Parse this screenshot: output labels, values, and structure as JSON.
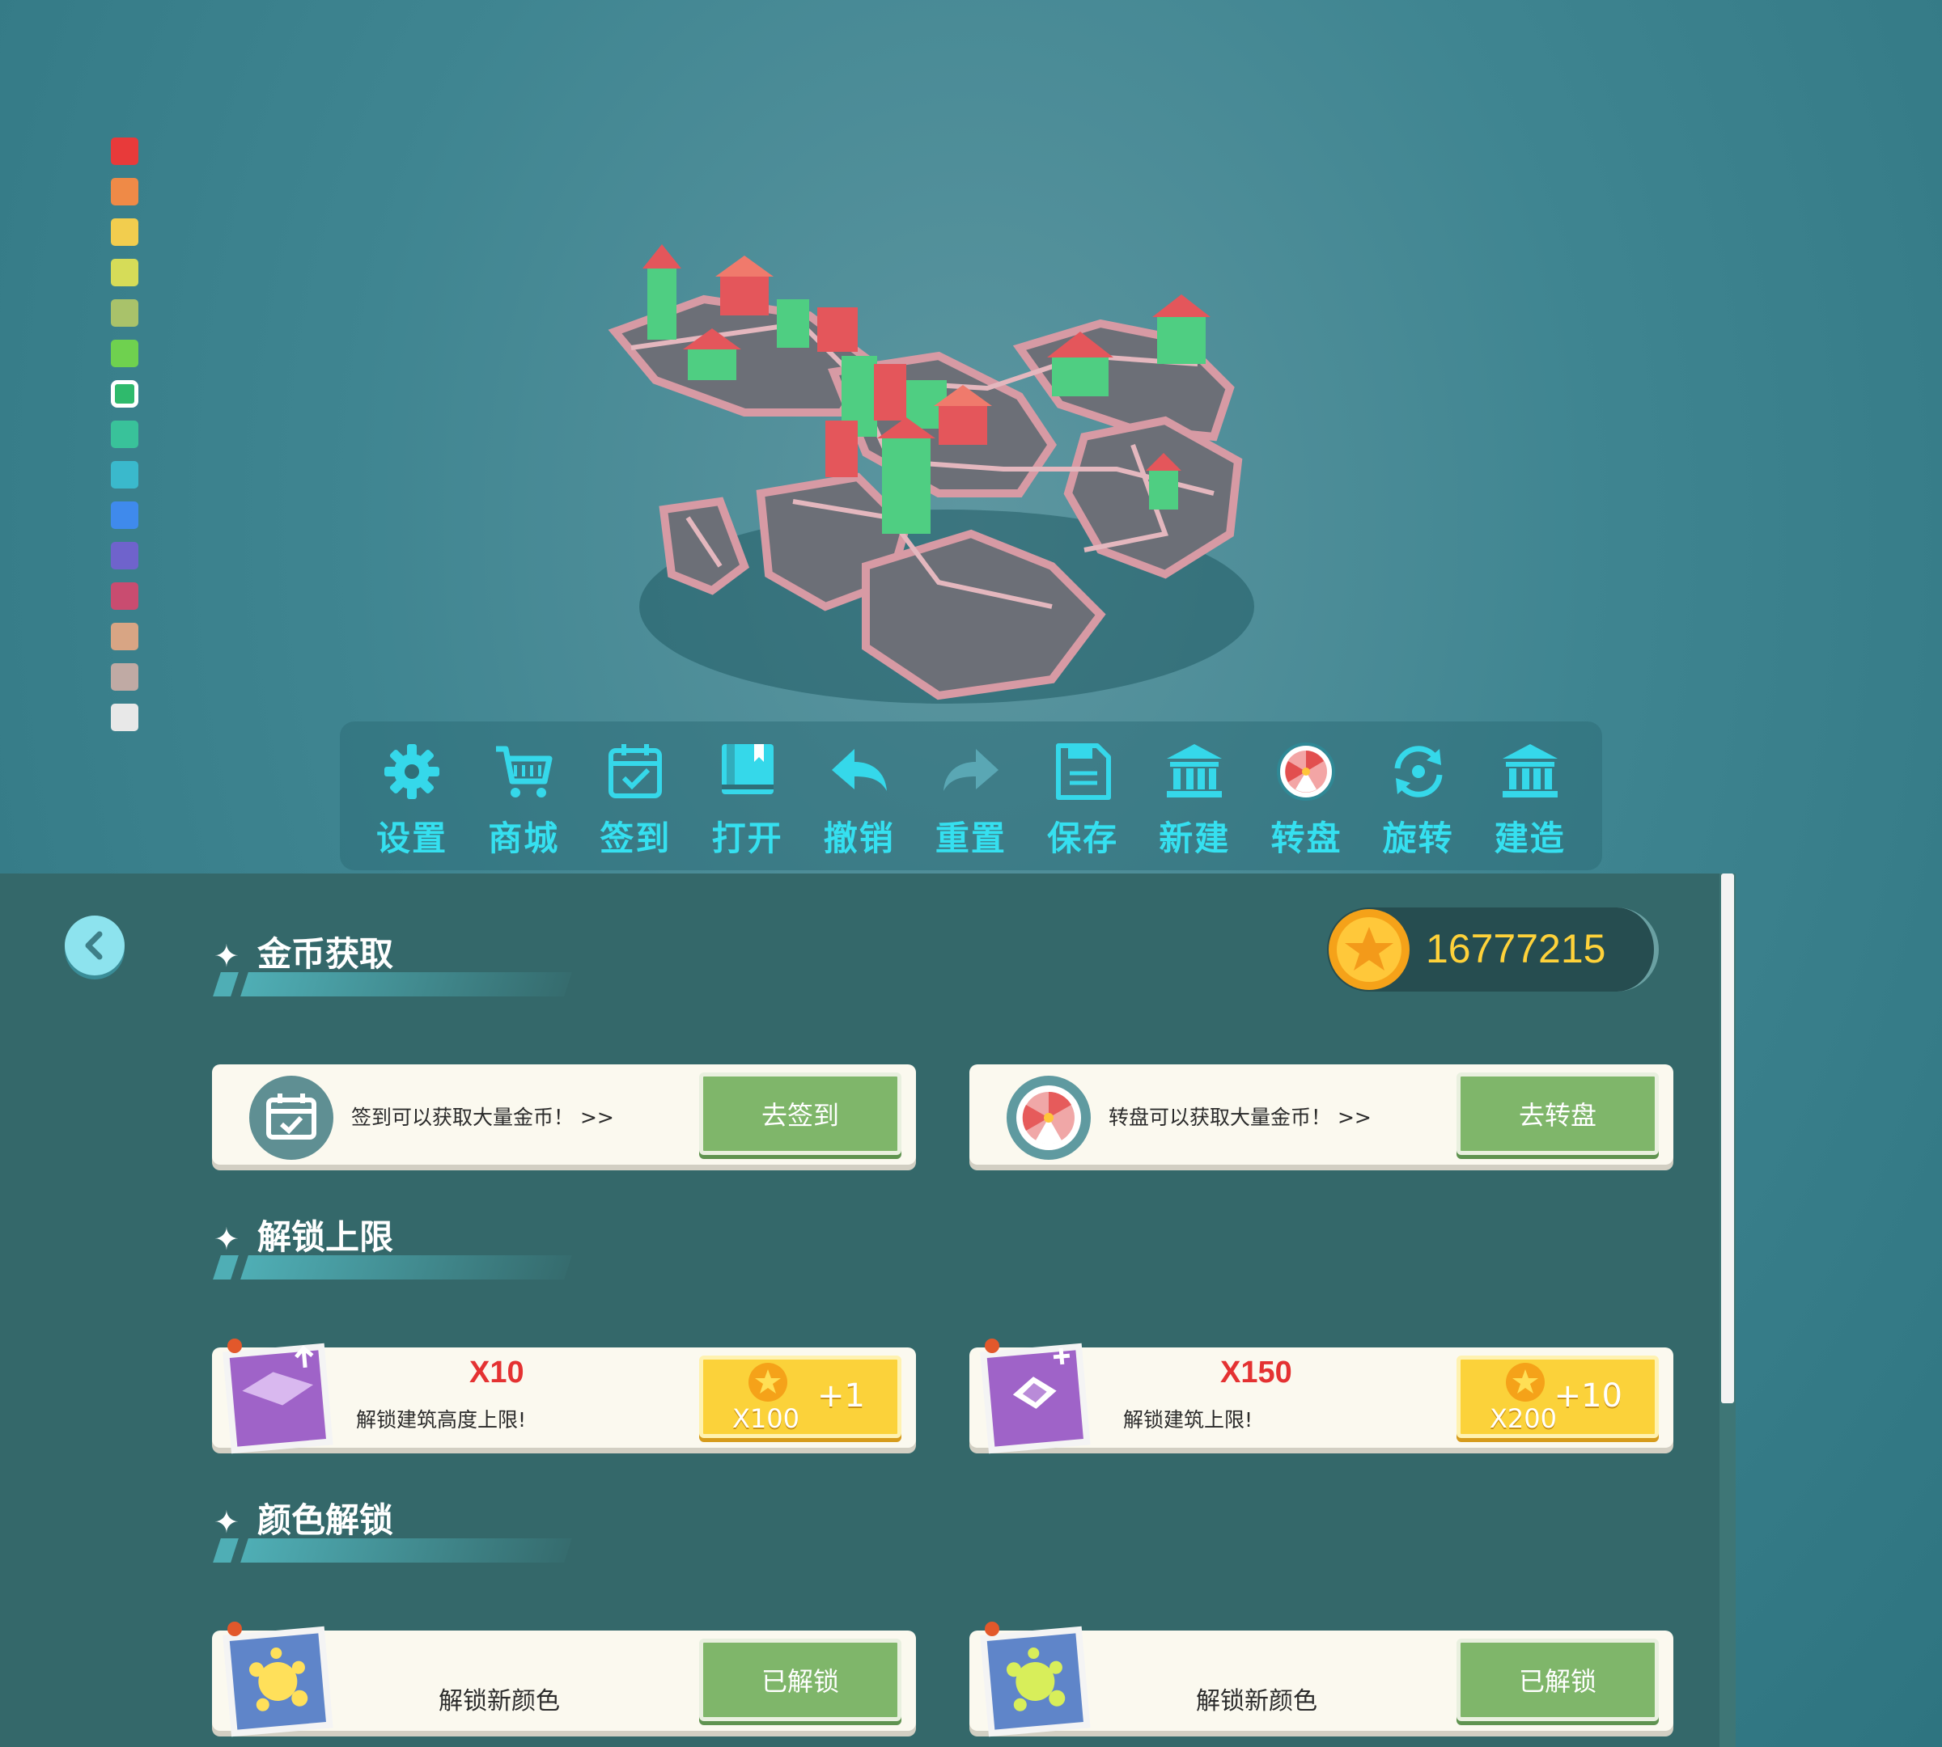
{
  "palette": {
    "colors": [
      "#e83a3a",
      "#ef8a47",
      "#f2cd4e",
      "#d6dc58",
      "#a9c26a",
      "#6fd14f",
      "#2fba6c",
      "#39c29a",
      "#3ab9cc",
      "#3f8aec",
      "#6f63cc",
      "#c94c70",
      "#d8a584",
      "#c0aaa4",
      "#e8e8e8"
    ],
    "selected_index": 6
  },
  "toolbar": {
    "items": [
      {
        "key": "settings",
        "label": "设置",
        "icon": "gear-icon"
      },
      {
        "key": "shop",
        "label": "商城",
        "icon": "cart-icon"
      },
      {
        "key": "checkin",
        "label": "签到",
        "icon": "calendar-icon"
      },
      {
        "key": "open",
        "label": "打开",
        "icon": "book-icon"
      },
      {
        "key": "undo",
        "label": "撤销",
        "icon": "undo-icon"
      },
      {
        "key": "redo",
        "label": "重置",
        "icon": "redo-icon"
      },
      {
        "key": "save",
        "label": "保存",
        "icon": "floppy-icon"
      },
      {
        "key": "new",
        "label": "新建",
        "icon": "building-icon"
      },
      {
        "key": "wheel",
        "label": "转盘",
        "icon": "wheel-icon"
      },
      {
        "key": "rotate",
        "label": "旋转",
        "icon": "rotate-icon"
      },
      {
        "key": "build",
        "label": "建造",
        "icon": "building-icon"
      }
    ]
  },
  "panel": {
    "coins": "16777215",
    "sections": {
      "earn": "金币获取",
      "unlock_limit": "解锁上限",
      "color_unlock": "颜色解锁"
    },
    "earn_cards": [
      {
        "desc": "签到可以获取大量金币！ >>",
        "button": "去签到",
        "icon": "calendar-icon"
      },
      {
        "desc": "转盘可以获取大量金币！ >>",
        "button": "去转盘",
        "icon": "wheel-icon"
      }
    ],
    "limit_cards": [
      {
        "amount": "X10",
        "desc": "解锁建筑高度上限!",
        "plus": "+1",
        "cost": "X100"
      },
      {
        "amount": "X150",
        "desc": "解锁建筑上限!",
        "plus": "+10",
        "cost": "X200"
      }
    ],
    "color_cards": [
      {
        "desc": "解锁新颜色",
        "button": "已解锁"
      },
      {
        "desc": "解锁新颜色",
        "button": "已解锁"
      }
    ]
  }
}
